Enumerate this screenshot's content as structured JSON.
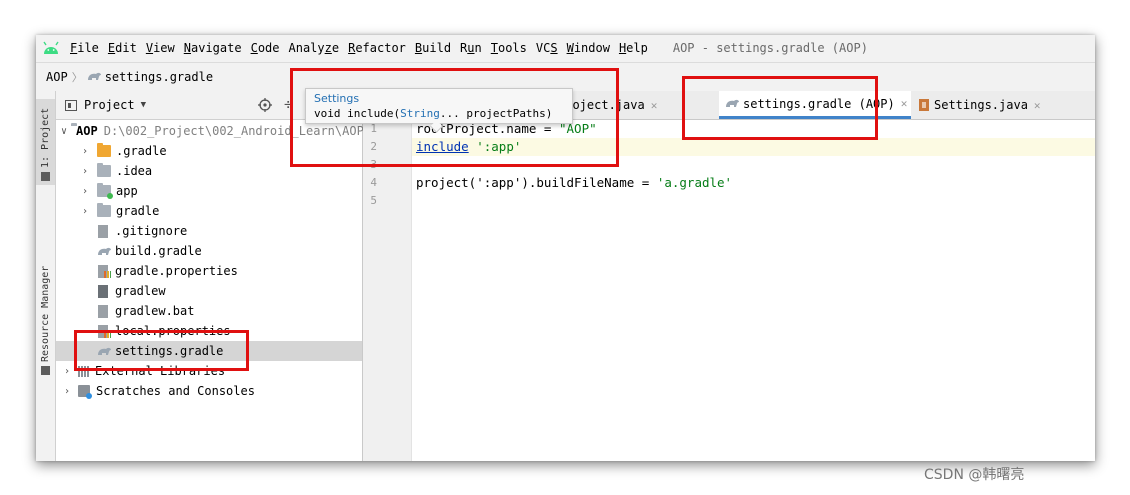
{
  "menubar": {
    "items": [
      "File",
      "Edit",
      "View",
      "Navigate",
      "Code",
      "Analyze",
      "Refactor",
      "Build",
      "Run",
      "Tools",
      "VCS",
      "Window",
      "Help"
    ],
    "mnemonics": [
      "F",
      "E",
      "V",
      "N",
      "C",
      "z",
      "R",
      "B",
      "u",
      "T",
      "S",
      "W",
      "H"
    ],
    "window_title": "AOP - settings.gradle (AOP)"
  },
  "navbar": {
    "project": "AOP",
    "file": "settings.gradle"
  },
  "sidestrip": {
    "project_tab": "1: Project",
    "resource_tab": "Resource Manager"
  },
  "project_panel": {
    "header_label": "Project",
    "tree": [
      {
        "label": "AOP",
        "detail": "D:\\002_Project\\002_Android_Learn\\AOP",
        "depth": 0,
        "expanded": true,
        "icon": "module-folder-icon"
      },
      {
        "label": ".gradle",
        "depth": 1,
        "expandable": true,
        "icon": "folder-orange-icon"
      },
      {
        "label": ".idea",
        "depth": 1,
        "expandable": true,
        "icon": "folder-icon"
      },
      {
        "label": "app",
        "depth": 1,
        "expandable": true,
        "icon": "android-module-icon"
      },
      {
        "label": "gradle",
        "depth": 1,
        "expandable": true,
        "icon": "folder-icon"
      },
      {
        "label": ".gitignore",
        "depth": 1,
        "icon": "gitignore-file-icon"
      },
      {
        "label": "build.gradle",
        "depth": 1,
        "icon": "gradle-file-icon"
      },
      {
        "label": "gradle.properties",
        "depth": 1,
        "icon": "properties-file-icon"
      },
      {
        "label": "gradlew",
        "depth": 1,
        "icon": "shell-file-icon"
      },
      {
        "label": "gradlew.bat",
        "depth": 1,
        "icon": "text-file-icon"
      },
      {
        "label": "local.properties",
        "depth": 1,
        "icon": "properties-file-icon"
      },
      {
        "label": "settings.gradle",
        "depth": 1,
        "icon": "gradle-file-icon",
        "selected": true
      },
      {
        "label": "External Libraries",
        "depth": 0,
        "expandable": true,
        "icon": "libraries-icon"
      },
      {
        "label": "Scratches and Consoles",
        "depth": 0,
        "expandable": true,
        "icon": "scratches-icon"
      }
    ]
  },
  "editor_tabs": [
    {
      "label": "Project.java",
      "active": false,
      "icon": "java-file-icon"
    },
    {
      "label": "settings.gradle (AOP)",
      "active": true,
      "icon": "gradle-file-icon"
    },
    {
      "label": "Settings.java",
      "active": false,
      "icon": "java-file-icon"
    }
  ],
  "code": {
    "line_numbers": [
      "1",
      "2",
      "3",
      "4",
      "5"
    ],
    "line1": {
      "text": "rootProject.name = ",
      "string": "\"AOP\""
    },
    "line2": {
      "keyword": "include",
      "string": "':app'"
    },
    "line4": {
      "text": "project(':app').buildFileName = ",
      "string": "'a.gradle'"
    }
  },
  "tooltip": {
    "title": "Settings",
    "prefix": "void include(",
    "type": "String",
    "suffix": "... projectPaths)"
  },
  "watermark": "CSDN @韩曙亮",
  "colors": {
    "highlight_box": "#e01010",
    "active_tab_underline": "#4083c9",
    "keyword_link": "#0033b3",
    "string": "#067d17"
  }
}
